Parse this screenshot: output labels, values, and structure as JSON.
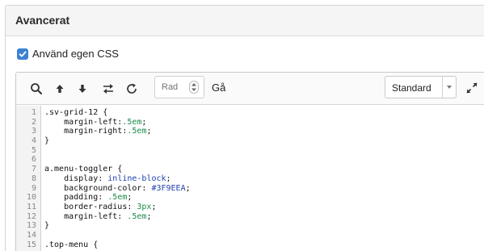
{
  "panel": {
    "title": "Avancerat"
  },
  "custom_css": {
    "label": "Använd egen CSS",
    "checked": true
  },
  "toolbar": {
    "icons": [
      "search-icon",
      "arrow-up-icon",
      "arrow-down-icon",
      "swap-icon",
      "refresh-icon",
      "expand-icon"
    ],
    "row_placeholder": "Rad",
    "go_label": "Gå",
    "mode_select": "Standard",
    "accent_color": "#3b82d4"
  },
  "code_lines": [
    {
      "n": "1",
      "text": ".sv-grid-12 {"
    },
    {
      "n": "2",
      "text": "    margin-left:.5em;",
      "prop": "    margin-left:",
      "val": ".5em",
      "tail": ";",
      "vt": "num"
    },
    {
      "n": "3",
      "text": "    margin-right:.5em;",
      "prop": "    margin-right:",
      "val": ".5em",
      "tail": ";",
      "vt": "num"
    },
    {
      "n": "4",
      "text": "}"
    },
    {
      "n": "5",
      "text": ""
    },
    {
      "n": "6",
      "text": ""
    },
    {
      "n": "7",
      "text": "a.menu-toggler {"
    },
    {
      "n": "8",
      "text": "    display: inline-block;",
      "prop": "    display: ",
      "val": "inline-block",
      "tail": ";",
      "vt": "kw"
    },
    {
      "n": "9",
      "text": "    background-color: #3F9EEA;",
      "prop": "    background-color: ",
      "val": "#3F9EEA",
      "tail": ";",
      "vt": "kw"
    },
    {
      "n": "10",
      "text": "    padding: .5em;",
      "prop": "    padding: ",
      "val": ".5em",
      "tail": ";",
      "vt": "num"
    },
    {
      "n": "11",
      "text": "    border-radius: 3px;",
      "prop": "    border-radius: ",
      "val": "3px",
      "tail": ";",
      "vt": "num"
    },
    {
      "n": "12",
      "text": "    margin-left: .5em;",
      "prop": "    margin-left: ",
      "val": ".5em",
      "tail": ";",
      "vt": "num"
    },
    {
      "n": "13",
      "text": "}"
    },
    {
      "n": "14",
      "text": ""
    },
    {
      "n": "15",
      "text": ".top-menu {"
    }
  ]
}
